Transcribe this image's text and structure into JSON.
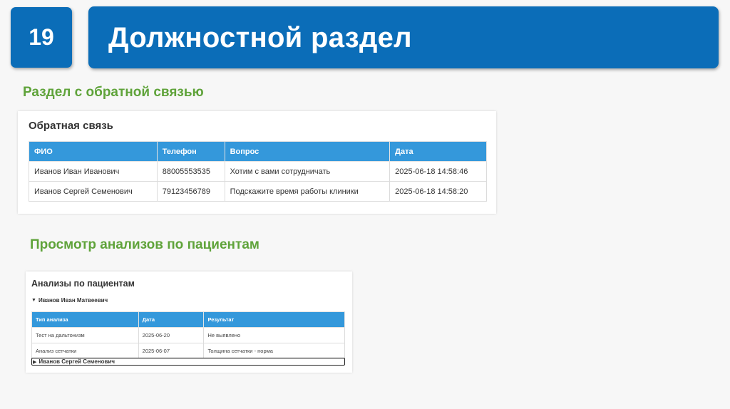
{
  "slide": {
    "number": "19",
    "title": "Должностной раздел"
  },
  "sections": {
    "feedback_heading": "Раздел с обратной связью",
    "analysis_heading": "Просмотр анализов по пациентам"
  },
  "feedback": {
    "title": "Обратная связь",
    "columns": [
      "ФИО",
      "Телефон",
      "Вопрос",
      "Дата"
    ],
    "rows": [
      [
        "Иванов Иван Иванович",
        "88005553535",
        "Хотим с вами сотрудничать",
        "2025-06-18 14:58:46"
      ],
      [
        "Иванов Сергей Семенович",
        "79123456789",
        "Подскажите время работы клиники",
        "2025-06-18 14:58:20"
      ]
    ]
  },
  "analysis": {
    "title": "Анализы по пациентам",
    "patients": [
      {
        "name": "Иванов Иван Матвеевич",
        "columns": [
          "Тип анализа",
          "Дата",
          "Результат"
        ],
        "rows": [
          [
            "Тест на дальтонизм",
            "2025-06-20",
            "Не выявлено"
          ],
          [
            "Анализ сетчатки",
            "2025-06-07",
            "Толщина сетчатки - норма"
          ]
        ]
      },
      {
        "name": "Иванов Сергей Семенович"
      }
    ]
  }
}
